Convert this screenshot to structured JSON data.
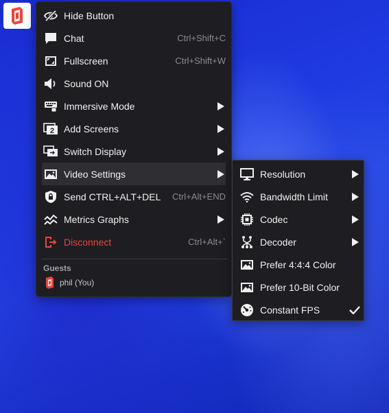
{
  "menu": {
    "items": [
      {
        "label": "Hide Button",
        "shortcut": "",
        "icon": "eye-slash-icon"
      },
      {
        "label": "Chat",
        "shortcut": "Ctrl+Shift+C",
        "icon": "chat-bubble-icon"
      },
      {
        "label": "Fullscreen",
        "shortcut": "Ctrl+Shift+W",
        "icon": "fullscreen-icon"
      },
      {
        "label": "Sound ON",
        "shortcut": "",
        "icon": "speaker-icon"
      },
      {
        "label": "Immersive Mode",
        "shortcut": "",
        "icon": "keyboard-lock-icon"
      },
      {
        "label": "Add Screens",
        "shortcut": "",
        "icon": "add-screens-icon",
        "badge": "2"
      },
      {
        "label": "Switch Display",
        "shortcut": "",
        "icon": "switch-display-icon"
      },
      {
        "label": "Video Settings",
        "shortcut": "",
        "icon": "image-icon"
      },
      {
        "label": "Send CTRL+ALT+DEL",
        "shortcut": "Ctrl+Alt+END",
        "icon": "shield-lock-icon"
      },
      {
        "label": "Metrics Graphs",
        "shortcut": "",
        "icon": "graph-icon"
      },
      {
        "label": "Disconnect",
        "shortcut": "Ctrl+Alt+`",
        "icon": "disconnect-icon"
      }
    ],
    "guests": {
      "header": "Guests",
      "list": [
        {
          "name": "phil (You)"
        }
      ]
    }
  },
  "submenu": {
    "items": [
      {
        "label": "Resolution",
        "icon": "monitor-icon"
      },
      {
        "label": "Bandwidth Limit",
        "icon": "wifi-icon"
      },
      {
        "label": "Codec",
        "icon": "chip-icon"
      },
      {
        "label": "Decoder",
        "icon": "decoder-icon"
      },
      {
        "label": "Prefer 4:4:4 Color",
        "icon": "image-icon"
      },
      {
        "label": "Prefer 10-Bit Color",
        "icon": "image-icon"
      },
      {
        "label": "Constant FPS",
        "icon": "gauge-icon",
        "checked": true
      }
    ]
  },
  "colors": {
    "menu_bg": "#1e1e22",
    "danger": "#e8453c",
    "brand": "#e8453c"
  }
}
